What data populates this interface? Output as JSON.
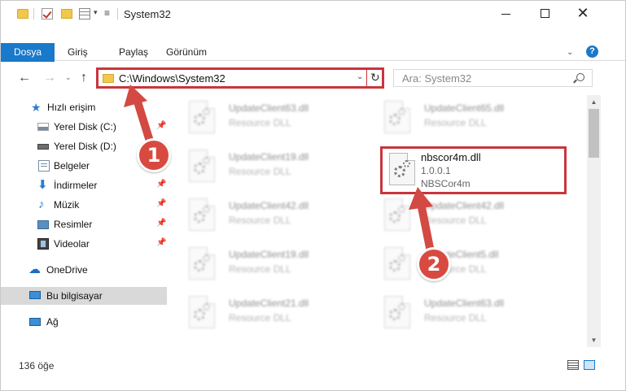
{
  "window": {
    "title": "System32",
    "controls": {
      "minimize": "—",
      "maximize": "",
      "close": "✕"
    }
  },
  "ribbon": {
    "tabs": [
      {
        "label": "Dosya"
      },
      {
        "label": "Giriş"
      },
      {
        "label": "Paylaş"
      },
      {
        "label": "Görünüm"
      }
    ],
    "help": "?"
  },
  "address": {
    "path": "C:\\Windows\\System32",
    "search_placeholder": "Ara: System32"
  },
  "nav": {
    "items": [
      {
        "label": "Hızlı erişim",
        "icon": "star-icon"
      },
      {
        "label": "Yerel Disk (C:)",
        "icon": "drive-icon",
        "pinned": true
      },
      {
        "label": "Yerel Disk (D:)",
        "icon": "drive-icon"
      },
      {
        "label": "Belgeler",
        "icon": "documents-icon",
        "pinned": true
      },
      {
        "label": "İndirmeler",
        "icon": "downloads-icon",
        "pinned": true
      },
      {
        "label": "Müzik",
        "icon": "music-icon",
        "pinned": true
      },
      {
        "label": "Resimler",
        "icon": "pictures-icon",
        "pinned": true
      },
      {
        "label": "Videolar",
        "icon": "videos-icon",
        "pinned": true
      },
      {
        "label": "OneDrive",
        "icon": "cloud-icon"
      },
      {
        "label": "Bu bilgisayar",
        "icon": "computer-icon",
        "selected": true
      },
      {
        "label": "Ağ",
        "icon": "network-icon"
      }
    ]
  },
  "files": [
    {
      "name": "UpdateClient63.dll",
      "desc": "Resource DLL"
    },
    {
      "name": "UpdateClient65.dll",
      "desc": "Resource DLL"
    },
    {
      "name": "UpdateClient19.dll",
      "desc": "Resource DLL"
    },
    {
      "name": "UpdateClient42.dll",
      "desc": "Resource DLL"
    },
    {
      "name": "UpdateClient42.dll",
      "desc": "Resource DLL"
    },
    {
      "name": "UpdateClient19.dll",
      "desc": "Resource DLL"
    },
    {
      "name": "UpdateClient5.dll",
      "desc": "Resource DLL"
    },
    {
      "name": "UpdateClient21.dll",
      "desc": "Resource DLL"
    },
    {
      "name": "UpdateClient63.dll",
      "desc": "Resource DLL"
    }
  ],
  "highlighted_file": {
    "name": "nbscor4m.dll",
    "version": "1.0.0.1",
    "product": "NBSCor4m"
  },
  "status": {
    "item_count": "136 öğe"
  },
  "callouts": {
    "one": "1",
    "two": "2"
  },
  "colors": {
    "accent": "#1979ca",
    "callout": "#d24a43"
  }
}
